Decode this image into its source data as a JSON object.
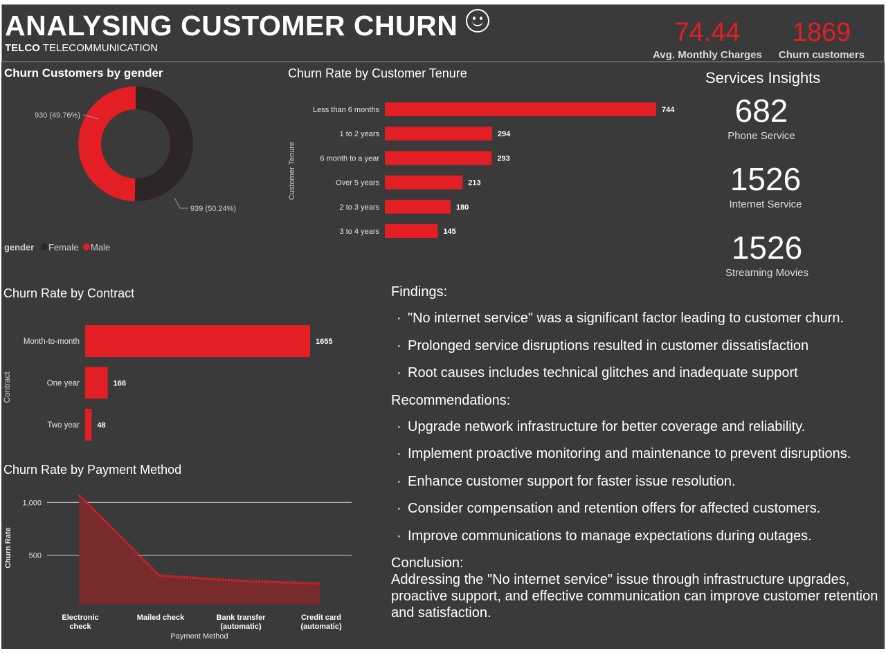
{
  "header": {
    "title": "ANALYSING CUSTOMER CHURN",
    "subtitle_bold": "TELCO",
    "subtitle_rest": "TELECOMMUNICATION",
    "kpis": [
      {
        "value": "74.44",
        "label": "Avg. Monthly Charges"
      },
      {
        "value": "1869",
        "label": "Churn customers"
      }
    ]
  },
  "gender_chart": {
    "title": "Churn Customers by gender",
    "legend_title": "gender",
    "female_label": "Female",
    "male_label": "Male",
    "female_value_label": "939 (50.24%)",
    "male_value_label": "930 (49.76%)"
  },
  "tenure_chart": {
    "title": "Churn Rate by Customer Tenure",
    "ylabel": "Customer Tenure"
  },
  "contract_chart": {
    "title": "Churn Rate by Contract",
    "ylabel": "Contract"
  },
  "payment_chart": {
    "title": "Churn Rate by Payment Method",
    "ylabel": "Churn Rate",
    "xlabel": "Payment Method"
  },
  "services": {
    "title": "Services Insights",
    "items": [
      {
        "value": "682",
        "label": "Phone Service"
      },
      {
        "value": "1526",
        "label": "Internet Service"
      },
      {
        "value": "1526",
        "label": "Streaming Movies"
      }
    ]
  },
  "findings": {
    "findings_title": "Findings:",
    "findings": [
      "\"No internet service\" was a significant factor leading to customer churn.",
      "Prolonged service disruptions resulted in customer dissatisfaction",
      "Root causes includes technical glitches and inadequate support"
    ],
    "recommendations_title": "Recommendations:",
    "recommendations": [
      "Upgrade network infrastructure for better coverage and reliability.",
      "Implement proactive monitoring and maintenance to prevent disruptions.",
      "Enhance customer support for faster issue resolution.",
      "Consider compensation and retention offers for affected customers.",
      "Improve communications to manage expectations during outages."
    ],
    "conclusion_title": "Conclusion:",
    "conclusion_text": "Addressing the \"No internet service\" issue through infrastructure upgrades, proactive support, and effective communication can improve customer retention and satisfaction."
  },
  "colors": {
    "accent": "#e31e24",
    "dark_series": "#2e2626",
    "background": "#3a3a3a"
  },
  "chart_data": [
    {
      "type": "pie",
      "title": "Churn Customers by gender",
      "categories": [
        "Female",
        "Male"
      ],
      "values": [
        939,
        930
      ],
      "percentages": [
        50.24,
        49.76
      ],
      "colors": [
        "#2e2626",
        "#e31e24"
      ],
      "legend": "bottom-left"
    },
    {
      "type": "bar",
      "orientation": "horizontal",
      "title": "Churn Rate by Customer Tenure",
      "ylabel": "Customer Tenure",
      "categories": [
        "Less than 6 months",
        "1 to 2 years",
        "6 month to a year",
        "Over 5 years",
        "2 to 3 years",
        "3 to 4 years"
      ],
      "values": [
        744,
        294,
        293,
        213,
        180,
        145
      ],
      "color": "#e31e24"
    },
    {
      "type": "bar",
      "orientation": "horizontal",
      "title": "Churn Rate by Contract",
      "ylabel": "Contract",
      "categories": [
        "Month-to-month",
        "One year",
        "Two year"
      ],
      "values": [
        1655,
        166,
        48
      ],
      "color": "#e31e24"
    },
    {
      "type": "area",
      "title": "Churn Rate by Payment Method",
      "xlabel": "Payment Method",
      "ylabel": "Churn Rate",
      "categories": [
        "Electronic check",
        "Mailed check",
        "Bank transfer (automatic)",
        "Credit card (automatic)"
      ],
      "values": [
        1071,
        308,
        258,
        232
      ],
      "yticks": [
        500,
        1000
      ],
      "ytick_labels": [
        "500",
        "1,000"
      ],
      "ylim": [
        0,
        1100
      ],
      "grid": true,
      "color": "#e31e24"
    }
  ]
}
